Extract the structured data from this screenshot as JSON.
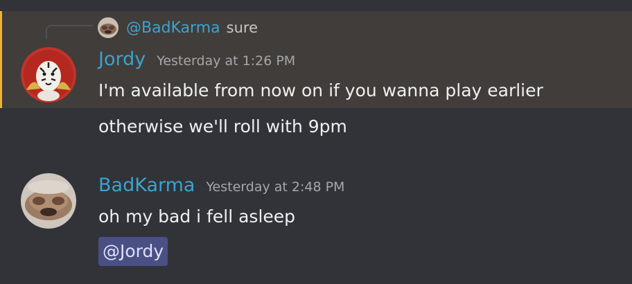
{
  "reply_reference": {
    "author": "@BadKarma",
    "text": "sure"
  },
  "messages": [
    {
      "author": "Jordy",
      "timestamp": "Yesterday at 1:26 PM",
      "lines": [
        "I'm available from now on if you wanna play earlier",
        "otherwise we'll roll with 9pm"
      ],
      "highlighted": true,
      "avatar_icon": "tiger-avatar"
    },
    {
      "author": "BadKarma",
      "timestamp": "Yesterday at 2:48 PM",
      "lines": [
        "oh my bad i fell asleep"
      ],
      "mention": "@Jordy",
      "avatar_icon": "blurry-face-avatar"
    }
  ],
  "colors": {
    "background": "#313338",
    "highlight_background": "#413d3a",
    "highlight_bar": "#f0b232",
    "author_name": "#3ba3d0",
    "timestamp": "#a5a7ad",
    "message_text": "#eef0f2",
    "mention_background": "#4a4f84",
    "mention_text": "#dee0fc"
  }
}
